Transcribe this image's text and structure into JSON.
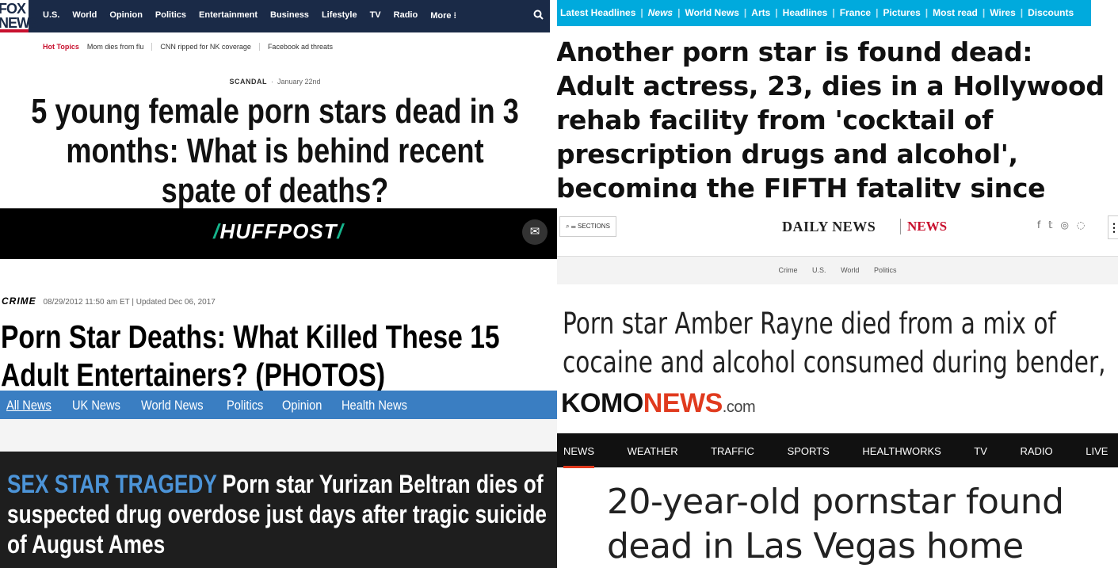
{
  "fox": {
    "logo_line1": "FOX",
    "logo_line2": "NEWS",
    "nav": [
      "U.S.",
      "World",
      "Opinion",
      "Politics",
      "Entertainment",
      "Business",
      "Lifestyle",
      "TV",
      "Radio",
      "More ⁝"
    ],
    "search_icon": "search-icon",
    "hot_topics_label": "Hot Topics",
    "hot_topics": [
      "Mom dies from flu",
      "CNN ripped for NK coverage",
      "Facebook ad threats"
    ],
    "category": "SCANDAL",
    "date": "January 22nd",
    "headline": "5 young female porn stars dead in 3 months: What is behind recent spate of deaths?"
  },
  "dailymail": {
    "nav": [
      "Latest Headlines",
      "News",
      "World News",
      "Arts",
      "Headlines",
      "France",
      "Pictures",
      "Most read",
      "Wires",
      "Discounts"
    ],
    "headline": "Another porn star is found dead: Adult actress, 23, dies in a Hollywood rehab facility from 'cocktail of prescription drugs and alcohol', becoming the FIFTH fatality since November"
  },
  "huffpost": {
    "logo_main": "HUFFPOST",
    "mail_icon": "envelope-icon",
    "section": "CRIME",
    "meta": "08/29/2012 11:50 am ET | Updated Dec 06, 2017",
    "headline": "Porn Star Deaths: What Killed These 15 Adult Entertainers? (PHOTOS)"
  },
  "dailynews": {
    "sections_label": "SECTIONS",
    "logo": "DAILY NEWS",
    "section": "NEWS",
    "social": "f 𝕥 ◎ ◌",
    "more": "⋮",
    "subnav": [
      "Crime",
      "U.S.",
      "World",
      "Politics"
    ],
    "headline": "Porn star Amber Rayne died from a mix of cocaine and alcohol consumed during bender, autopsy shows"
  },
  "independent": {
    "nav": [
      "All News",
      "UK News",
      "World News",
      "Politics",
      "Opinion",
      "Health News"
    ],
    "kicker": "SEX STAR TRAGEDY",
    "headline": "Porn star Yurizan Beltran dies of suspected drug overdose just days after tragic suicide of August Ames"
  },
  "komo": {
    "logo_part1": "KOMO",
    "logo_part2": "NEWS",
    "logo_part3": ".com",
    "nav": [
      "NEWS",
      "WEATHER",
      "TRAFFIC",
      "SPORTS",
      "HEALTHWORKS",
      "TV",
      "RADIO",
      "LIVE"
    ],
    "headline": "20-year-old pornstar found dead in Las Vegas home"
  }
}
